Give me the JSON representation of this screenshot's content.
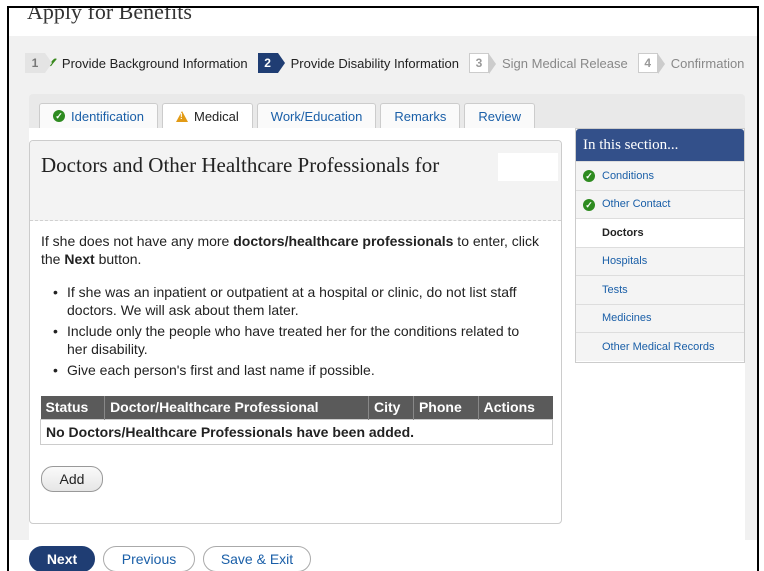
{
  "app_title": "Apply for Benefits",
  "steps": [
    {
      "num": "1",
      "label": "Provide Background Information",
      "status": "done"
    },
    {
      "num": "2",
      "label": "Provide Disability Information",
      "status": "current"
    },
    {
      "num": "3",
      "label": "Sign Medical Release",
      "status": "future"
    },
    {
      "num": "4",
      "label": "Confirmation",
      "status": "future"
    }
  ],
  "tabs": [
    {
      "label": "Identification"
    },
    {
      "label": "Medical"
    },
    {
      "label": "Work/Education"
    },
    {
      "label": "Remarks"
    },
    {
      "label": "Review"
    }
  ],
  "panel": {
    "title": "Doctors and Other Healthcare Professionals for",
    "intro_pre": "If she does not have any more ",
    "intro_bold": "doctors/healthcare professionals",
    "intro_mid": " to enter, click the ",
    "intro_next": "Next",
    "intro_post": " button.",
    "bullets": [
      "If she was an inpatient or outpatient at a hospital or clinic, do not list staff doctors. We will ask about them later.",
      "Include only the people who have treated her for the conditions related to her disability.",
      "Give each person's first and last name if possible."
    ],
    "table": {
      "headers": [
        "Status",
        "Doctor/Healthcare Professional",
        "City",
        "Phone",
        "Actions"
      ],
      "empty_message": "No Doctors/Healthcare Professionals have been added."
    },
    "add_label": "Add"
  },
  "sidebar": {
    "title": "In this section...",
    "items": [
      {
        "label": "Conditions",
        "completed": true
      },
      {
        "label": "Other Contact",
        "completed": true
      },
      {
        "label": "Doctors",
        "completed": false
      },
      {
        "label": "Hospitals",
        "completed": false
      },
      {
        "label": "Tests",
        "completed": false
      },
      {
        "label": "Medicines",
        "completed": false
      },
      {
        "label": "Other Medical Records",
        "completed": false
      }
    ]
  },
  "footer": {
    "next_label": "Next",
    "previous_label": "Previous",
    "save_exit_label": "Save & Exit"
  },
  "colors": {
    "primary": "#1f3d73",
    "link": "#1a5fa8",
    "complete_green": "#2e8b20",
    "warning_orange": "#e29b16",
    "table_header": "#5a5a5a"
  }
}
